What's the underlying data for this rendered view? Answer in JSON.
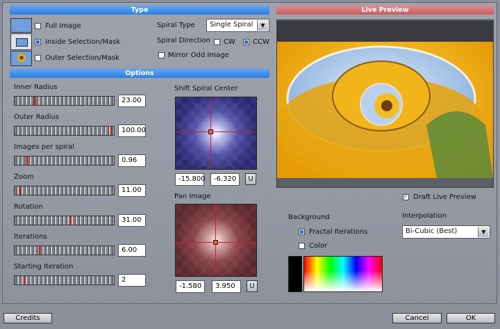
{
  "type_section": {
    "title": "Type",
    "options": [
      {
        "label": "Full Image",
        "checked": false
      },
      {
        "label": "Inside Selection/Mask",
        "checked": true
      },
      {
        "label": "Outer Selection/Mask",
        "checked": false
      }
    ],
    "spiral_type_label": "Spiral Type",
    "spiral_type_value": "Single Spiral",
    "spiral_direction_label": "Spiral Direction",
    "cw_label": "CW",
    "cw_checked": false,
    "ccw_label": "CCW",
    "ccw_checked": true,
    "mirror_label": "Mirror Odd Image",
    "mirror_checked": false
  },
  "options_section": {
    "title": "Options",
    "sliders": [
      {
        "label": "Inner Radius",
        "value": "23.00",
        "fraction": 0.2
      },
      {
        "label": "Outer Radius",
        "value": "100.00",
        "fraction": 0.98
      },
      {
        "label": "Images per spiral",
        "value": "0.96",
        "fraction": 0.12
      },
      {
        "label": "Zoom",
        "value": "11.00",
        "fraction": 0.05
      },
      {
        "label": "Rotation",
        "value": "31.00",
        "fraction": 0.57
      },
      {
        "label": "Iterations",
        "value": "6.00",
        "fraction": 0.25
      },
      {
        "label": "Starting Iteration",
        "value": "2",
        "fraction": 0.1
      }
    ],
    "shift_center": {
      "label": "Shift Spiral Center",
      "x": "-15.800",
      "y": "-6.320",
      "u_label": "U"
    },
    "pan_image": {
      "label": "Pan Image",
      "x": "-1.580",
      "y": "3.950",
      "u_label": "U"
    }
  },
  "live_preview": {
    "title": "Live Preview",
    "draft_label": "Draft Live Preview",
    "draft_checked": true
  },
  "background": {
    "label": "Background",
    "fractal_label": "Fractal Iterations",
    "fractal_checked": true,
    "color_label": "Color",
    "color_checked": false
  },
  "interpolation": {
    "label": "Interpolation",
    "value": "Bi-Cubic (Best)"
  },
  "footer": {
    "credits": "Credits",
    "cancel": "Cancel",
    "ok": "OK"
  },
  "colors": {
    "type_bar": "#3d8cee",
    "preview_bar": "#d0797c",
    "marker": "#d11111"
  }
}
